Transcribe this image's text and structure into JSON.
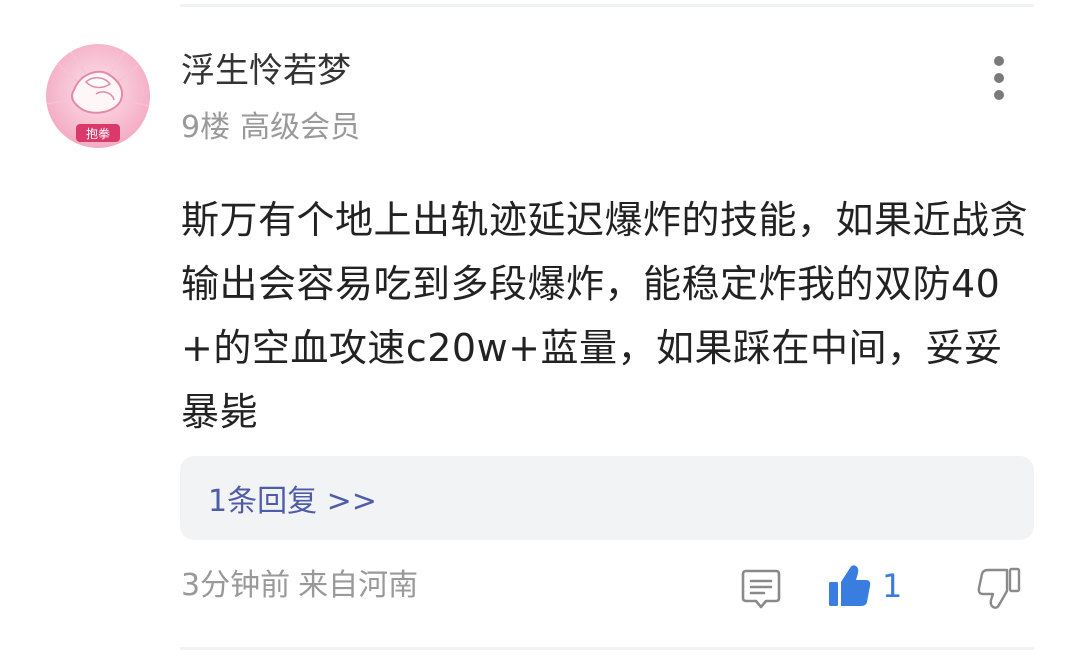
{
  "comment": {
    "username": "浮生怜若梦",
    "floor": "9楼",
    "member_level": "高级会员",
    "avatar_caption": "抱拳",
    "text": "斯万有个地上出轨迹延迟爆炸的技能，如果近战贪输出会容易吃到多段爆炸，能稳定炸我的双防40+的空血攻速c20w+蓝量，如果踩在中间，妥妥暴毙",
    "reply_link": "1条回复 >>",
    "time": "3分钟前",
    "location": "来自河南",
    "like_count": "1"
  },
  "icons": {
    "more": "more-vertical-icon",
    "comment": "comment-icon",
    "like": "thumbs-up-icon",
    "dislike": "thumbs-down-icon"
  },
  "colors": {
    "link": "#4f5da8",
    "like_active": "#3a7de0",
    "muted_text": "#999999",
    "reply_bg": "#f2f3f5"
  }
}
